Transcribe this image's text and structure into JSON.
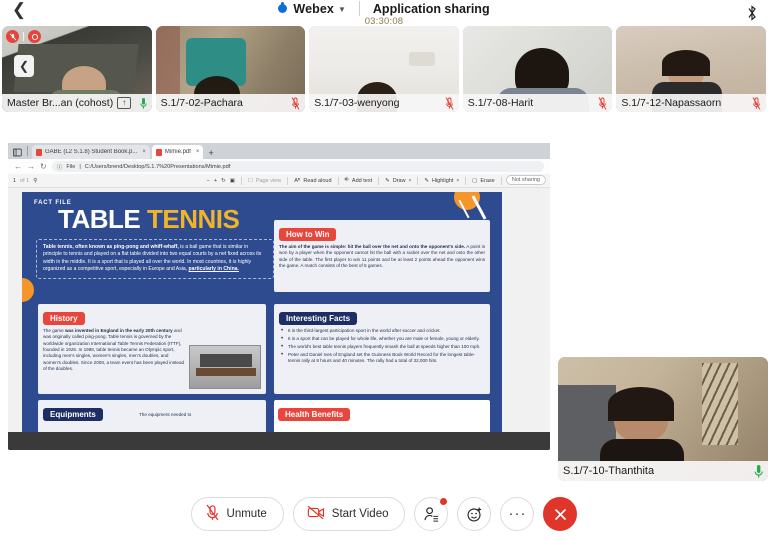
{
  "topbar": {
    "back_icon": "chevron-left-icon",
    "app_name": "Webex",
    "dropdown_icon": "chevron-down-icon",
    "screen_title": "Application sharing",
    "timer": "03:30:08",
    "bluetooth_icon": "bluetooth-icon"
  },
  "filmstrip": {
    "scroll_left_icon": "chevron-left-icon",
    "participants": [
      {
        "name": "Master Br...an (cohost)",
        "host_badge": "↑",
        "mic": "on",
        "badges": [
          "mute-all-badge",
          "record-badge"
        ]
      },
      {
        "name": "S.1/7-02-Pachara",
        "mic": "off",
        "badges": []
      },
      {
        "name": "S.1/7-03-wenyong",
        "mic": "off",
        "badges": []
      },
      {
        "name": "S.1/7-08-Harit",
        "mic": "off",
        "badges": []
      },
      {
        "name": "S.1/7-12-Napassaorn",
        "mic": "off",
        "badges": []
      }
    ]
  },
  "self_video": {
    "name": "S.1/7-10-Thanthita",
    "mic": "on"
  },
  "shared_screen": {
    "browser": {
      "window_icon": "app-window-icon",
      "tabs": [
        {
          "title": "GABE (L2 S.1.8) Student Book.p...",
          "active": false,
          "favicon": "pdf-icon",
          "close": "×"
        },
        {
          "title": "Mimie.pdf",
          "active": true,
          "favicon": "pdf-icon",
          "close": "×"
        }
      ],
      "new_tab": "+",
      "nav": {
        "back": "←",
        "forward": "→",
        "reload": "↻"
      },
      "url_prefix": "File",
      "url": "C:/Users/brend/Desktop/S.1.7%20Presentations/Mimie.pdf",
      "info_icon": "info-icon"
    },
    "pdf_toolbar": {
      "page_current": "1",
      "page_total": "of 1",
      "search_icon": "search-icon",
      "zoom_out": "−",
      "zoom_in": "+",
      "rotate": "↻",
      "fit": "fit-page-icon",
      "page_view": "Page view",
      "read_aloud": "Read aloud",
      "add_text": "Add text",
      "draw": "Draw",
      "highlight": "Highlight",
      "erase": "Erase",
      "save_icon": "save-icon",
      "print_icon": "print-icon",
      "share_icon": "share-icon",
      "pin_icon": "pin-icon",
      "now_sharing": "Not sharing"
    },
    "poster": {
      "eyebrow": "FACT FILE",
      "title_word1": "TABLE",
      "title_word2": "TENNIS",
      "intro_bold": "Table tennis, often known as ping-pong and whiff-whaff,",
      "intro_rest": " is a ball game that is similar in principle to tennis and played on a flat table divided into two equal courts by a net fixed across its width in the middle. It is a sport that is played all over the world. In most countries, it is highly organized as a competitive sport, especially in Europe and Asia, ",
      "intro_underline": "particularly in China.",
      "sections": [
        {
          "id": "how-to-win",
          "heading": "How to Win",
          "heading_color": "red",
          "bold_lead": "The aim of the game is simple: hit the ball over the net and onto the opponent's side.",
          "body": " A point is won by a player when the opponent cannot hit the ball with a racket over the net and onto the other side of the table. The first player to win 11 points and be at least 2 points ahead the opponent wins the game. A match consists of the best of 5 games."
        },
        {
          "id": "history",
          "heading": "History",
          "heading_color": "red",
          "bold_lead": "The game ",
          "body_bold": "was invented in England in the early 20th century",
          "body": " and was originally called ping-pong. Table tennis is governed by the worldwide organization International Table Tennis Federation (ITTF), founded in 1926. In 1988, table tennis became an Olympic sport, including men's singles, women's singles, men's doubles, and women's doubles. Since 2008, a team event has been played instead of the doubles."
        },
        {
          "id": "interesting-facts",
          "heading": "Interesting Facts",
          "heading_color": "navy",
          "bullets": [
            "It is the third-largest participation sport in the world after soccer and cricket.",
            "It is a sport that can be played for whole life, whether you are male or female, young or elderly.",
            "The world's best table tennis players frequently smash the ball at speeds higher than 100 mph.",
            "Peter and Daniel Ives of England set the Guinness Book World Record for the longest table-tennis rally at 8 hours and 40 minutes. The rally had a total of 32,000 hits."
          ]
        },
        {
          "id": "equipments",
          "heading": "Equipments",
          "heading_color": "navy",
          "body": "The equipment needed to"
        },
        {
          "id": "health-benefits",
          "heading": "Health Benefits",
          "heading_color": "red",
          "body": ""
        }
      ]
    }
  },
  "controls": {
    "unmute": {
      "label": "Unmute",
      "icon": "mic-muted-icon"
    },
    "start_video": {
      "label": "Start Video",
      "icon": "video-off-icon"
    },
    "participants": {
      "icon": "participants-icon",
      "has_badge": true
    },
    "reactions": {
      "icon": "reaction-smiley-icon"
    },
    "more": {
      "icon": "more-horizontal-icon",
      "label": "···"
    },
    "end_call": {
      "icon": "close-x-icon"
    }
  },
  "colors": {
    "accent_red": "#e0352b",
    "webex_blue": "#1170cf",
    "poster_navy": "#2f4b8f",
    "poster_gold": "#f0b429",
    "timer_text": "#8a7a4e"
  }
}
